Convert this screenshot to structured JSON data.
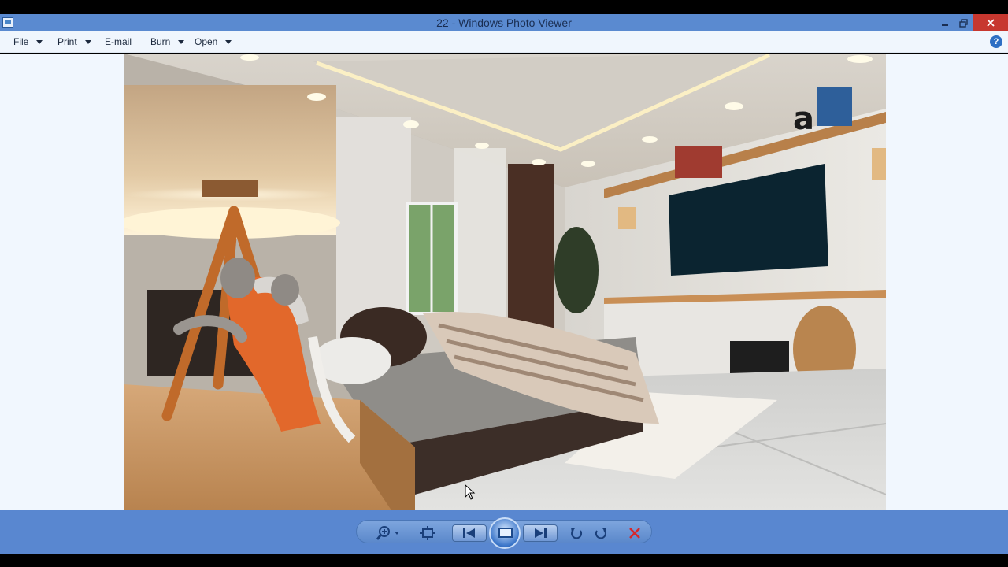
{
  "window": {
    "title": "22 - Windows Photo Viewer"
  },
  "titlebar_icons": [
    "app-icon",
    "minimize-icon",
    "restore-icon",
    "close-icon"
  ],
  "menu": {
    "items": [
      {
        "label": "File",
        "has_dropdown": true
      },
      {
        "label": "Print",
        "has_dropdown": true
      },
      {
        "label": "E-mail",
        "has_dropdown": false
      },
      {
        "label": "Burn",
        "has_dropdown": true
      },
      {
        "label": "Open",
        "has_dropdown": true
      }
    ],
    "help_icon": "help-icon"
  },
  "toolbar": {
    "icons": [
      "zoom-icon",
      "actual-size-icon",
      "previous-icon",
      "slideshow-icon",
      "next-icon",
      "rotate-counterclockwise-icon",
      "rotate-clockwise-icon",
      "delete-icon"
    ]
  },
  "photo": {
    "subject": "bedroom-interior-render"
  },
  "colors": {
    "titlebar": "#5a8ad0",
    "menubar": "#f0f6fd",
    "viewer_bg": "#f1f7fe",
    "toolbar": "#5987d0",
    "close_button": "#c7372f",
    "delete_icon": "#d8282a"
  }
}
